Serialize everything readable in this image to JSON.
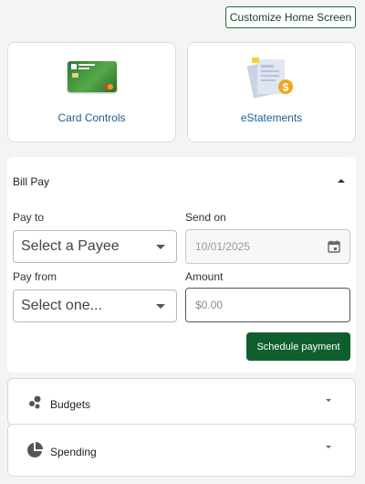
{
  "header": {
    "customize_label": "Customize Home Screen"
  },
  "tiles": [
    {
      "label": "Card Controls",
      "icon": "credit-card-icon"
    },
    {
      "label": "eStatements",
      "icon": "estatement-icon"
    }
  ],
  "bill_pay": {
    "title": "Bill Pay",
    "pay_to_label": "Pay to",
    "pay_to_value": "Select a Payee",
    "send_on_label": "Send on",
    "send_on_value": "10/01/2025",
    "pay_from_label": "Pay from",
    "pay_from_value": "Select one...",
    "amount_label": "Amount",
    "amount_placeholder": "$0.00",
    "schedule_label": "Schedule payment"
  },
  "sections": [
    {
      "label": "Budgets",
      "icon": "budgets-icon"
    },
    {
      "label": "Spending",
      "icon": "pie-chart-icon"
    }
  ],
  "colors": {
    "accent_green": "#0f5e2e",
    "link_blue": "#1a6098",
    "estatement_coin": "#f2a71b"
  }
}
